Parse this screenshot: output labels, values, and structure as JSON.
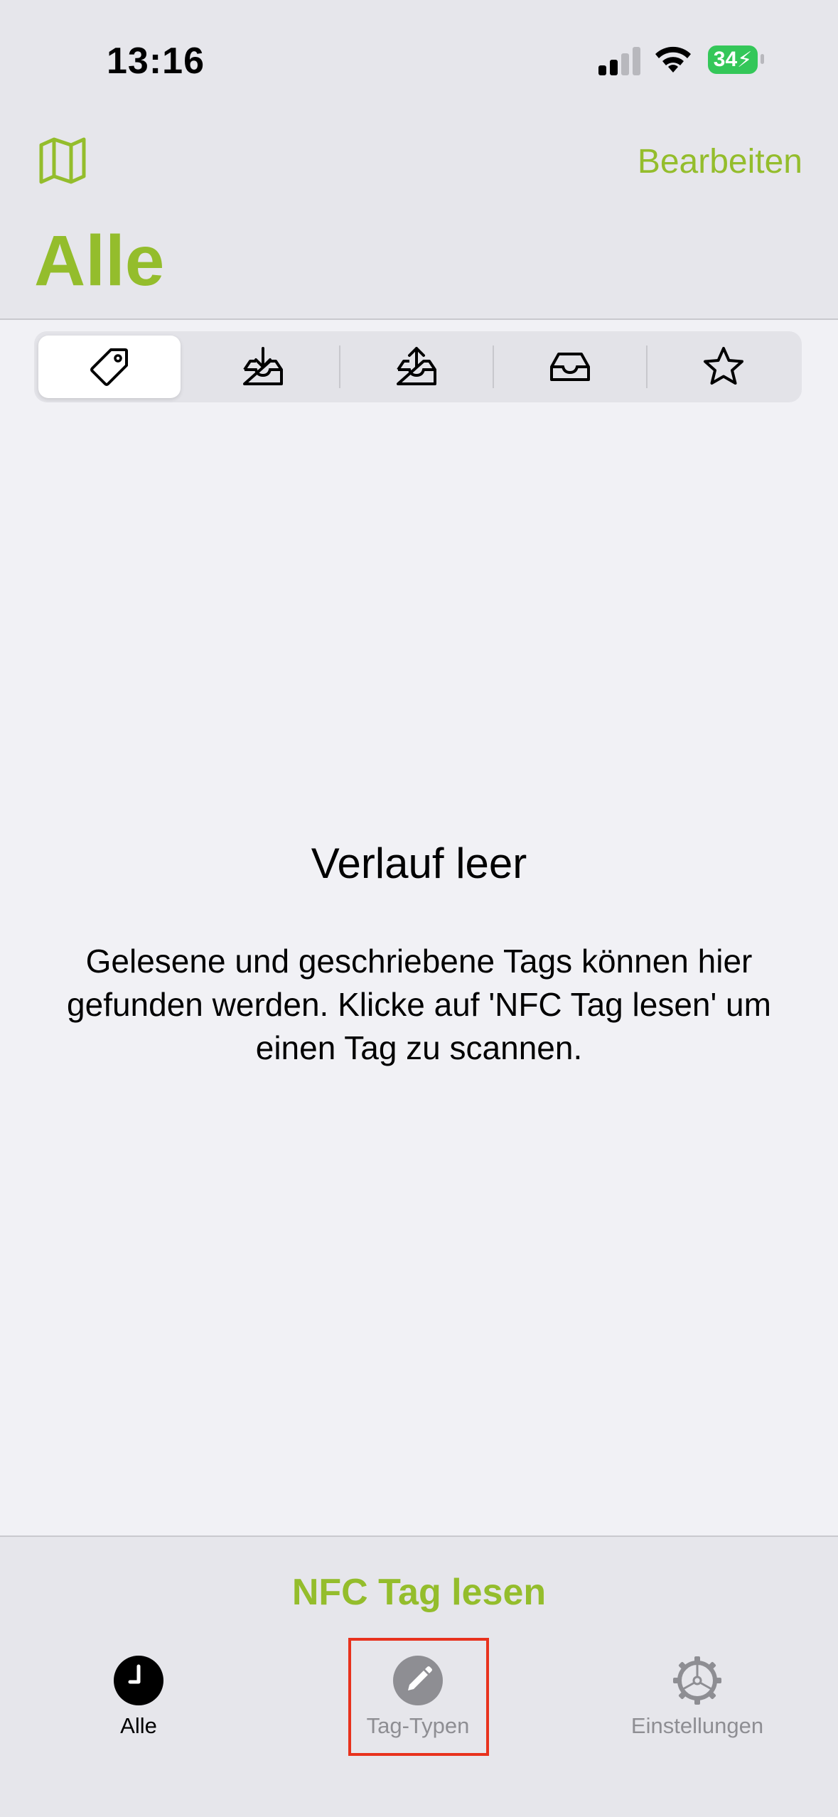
{
  "status_bar": {
    "time": "13:16",
    "battery": "34"
  },
  "nav": {
    "edit_label": "Bearbeiten",
    "title": "Alle"
  },
  "filters": [
    {
      "icon": "tag-icon",
      "active": true
    },
    {
      "icon": "tray-download-icon",
      "active": false
    },
    {
      "icon": "tray-upload-icon",
      "active": false
    },
    {
      "icon": "tray-icon",
      "active": false
    },
    {
      "icon": "star-icon",
      "active": false
    }
  ],
  "empty_state": {
    "title": "Verlauf leer",
    "body": "Gelesene und geschriebene Tags können hier gefunden werden. Klicke auf 'NFC Tag lesen' um einen Tag zu scannen."
  },
  "action": {
    "read_label": "NFC Tag lesen"
  },
  "tabs": [
    {
      "label": "Alle",
      "icon": "clock-icon",
      "selected": true
    },
    {
      "label": "Tag-Typen",
      "icon": "pencil-icon",
      "selected": false
    },
    {
      "label": "Einstellungen",
      "icon": "gear-icon",
      "selected": false
    }
  ],
  "colors": {
    "accent": "#94bd2c",
    "highlight": "#e8321d",
    "battery": "#34c759"
  }
}
